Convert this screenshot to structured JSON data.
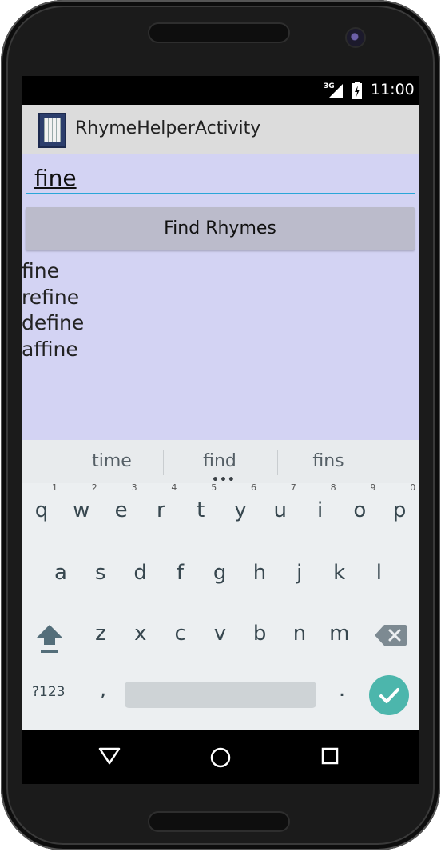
{
  "status_bar": {
    "network": "3G",
    "time": "11:00"
  },
  "action_bar": {
    "title": "RhymeHelperActivity",
    "icon": "notebook-icon"
  },
  "main": {
    "input_value": "fine",
    "button_label": "Find Rhymes",
    "rhymes": [
      "fine",
      "refine",
      "define",
      "affine"
    ]
  },
  "keyboard": {
    "suggestions": [
      "time",
      "find",
      "fins"
    ],
    "row1": [
      {
        "key": "q",
        "hint": "1"
      },
      {
        "key": "w",
        "hint": "2"
      },
      {
        "key": "e",
        "hint": "3"
      },
      {
        "key": "r",
        "hint": "4"
      },
      {
        "key": "t",
        "hint": "5"
      },
      {
        "key": "y",
        "hint": "6"
      },
      {
        "key": "u",
        "hint": "7"
      },
      {
        "key": "i",
        "hint": "8"
      },
      {
        "key": "o",
        "hint": "9"
      },
      {
        "key": "p",
        "hint": "0"
      }
    ],
    "row2": [
      "a",
      "s",
      "d",
      "f",
      "g",
      "h",
      "j",
      "k",
      "l"
    ],
    "row3": [
      "z",
      "x",
      "c",
      "v",
      "b",
      "n",
      "m"
    ],
    "symbols_label": "?123",
    "comma": ",",
    "period": ".",
    "accent_color": "#4cb6ac"
  },
  "colors": {
    "content_background": "#d3d3f3",
    "input_underline": "#2aa6d8",
    "button_background": "#bbbbcb"
  }
}
